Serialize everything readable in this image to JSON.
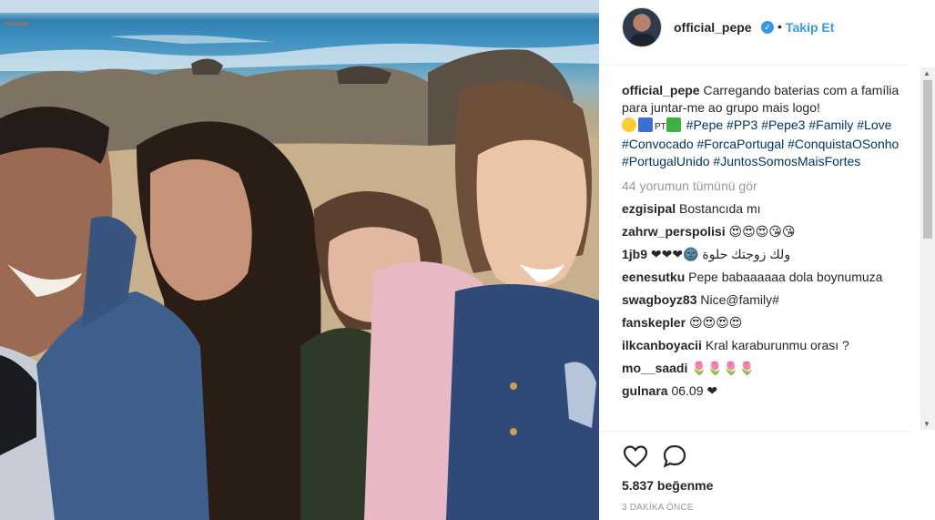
{
  "post": {
    "username": "official_pepe",
    "verified_mark": "✓",
    "separator": "•",
    "follow_label": "Takip Et"
  },
  "caption": {
    "username": "official_pepe",
    "text": "Carregando baterias com a família para juntar-me ao grupo mais logo!",
    "flag_text": "PT",
    "hashtags": [
      "#Pepe",
      "#PP3",
      "#Pepe3",
      "#Family",
      "#Love",
      "#Convocado",
      "#ForcaPortugal",
      "#ConquistaOSonho",
      "#PortugalUnido",
      "#JuntosSomosMaisFortes"
    ]
  },
  "view_all_comments": "44 yorumun tümünü gör",
  "comments": [
    {
      "user": "ezgisipal",
      "text": "Bostancıda mı"
    },
    {
      "user": "zahrw_perspolisi",
      "text": "😍😍😍😘😘"
    },
    {
      "user": "1jb9",
      "text": "ولك زوجتك حلوة 🌚❤❤❤"
    },
    {
      "user": "eenesutku",
      "text": "Pepe babaaaaaa dola boynumuza"
    },
    {
      "user": "swagboyz83",
      "text": "Nice@family#"
    },
    {
      "user": "fanskepler",
      "text": "😍😍😍😍"
    },
    {
      "user": "ilkcanboyacii",
      "text": "Kral karaburunmu orası ?"
    },
    {
      "user": "mo__saadi",
      "text": "🌷🌷🌷🌷"
    },
    {
      "user": "gulnara",
      "text": "06.09 ❤"
    }
  ],
  "likes": "5.837 beğenme",
  "timestamp": "3 DAKİKA ÖNCE",
  "icons": {
    "like": "heart-outline-icon",
    "comment": "speech-bubble-icon",
    "verified": "verified-badge-icon"
  },
  "colors": {
    "link": "#003569",
    "follow": "#3897f0",
    "muted": "#999999",
    "verified": "#3897f0"
  }
}
